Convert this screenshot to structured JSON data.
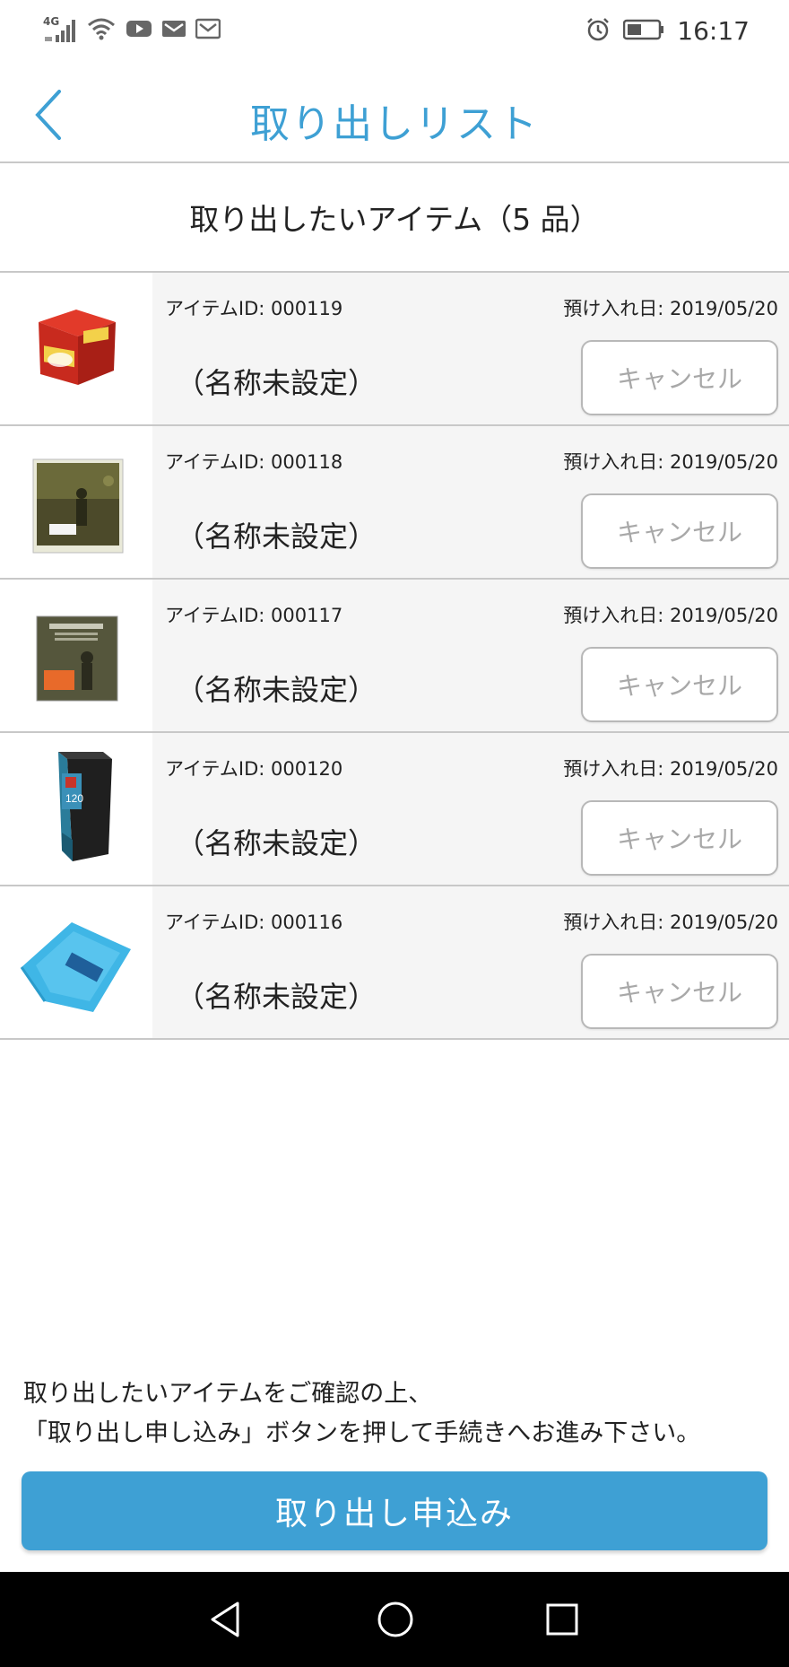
{
  "status_bar": {
    "network_label": "4G",
    "time": "16:17",
    "icons": [
      "signal-icon",
      "wifi-icon",
      "youtube-icon",
      "gmail-icon",
      "gmail-icon",
      "alarm-icon",
      "battery-icon"
    ]
  },
  "header": {
    "back_icon": "chevron-left-icon",
    "title": "取り出しリスト"
  },
  "section": {
    "heading": "取り出したいアイテム（5 品）"
  },
  "items": [
    {
      "id_label": "アイテムID: 000119",
      "date_label": "預け入れ日: 2019/05/20",
      "name": "（名称未設定）",
      "cancel_label": "キャンセル",
      "thumb": "red-tin-box-image"
    },
    {
      "id_label": "アイテムID: 000118",
      "date_label": "預け入れ日: 2019/05/20",
      "name": "（名称未設定）",
      "cancel_label": "キャンセル",
      "thumb": "vinyl-record-image"
    },
    {
      "id_label": "アイテムID: 000117",
      "date_label": "預け入れ日: 2019/05/20",
      "name": "（名称未設定）",
      "cancel_label": "キャンセル",
      "thumb": "vinyl-record-image"
    },
    {
      "id_label": "アイテムID: 000120",
      "date_label": "預け入れ日: 2019/05/20",
      "name": "（名称未設定）",
      "cancel_label": "キャンセル",
      "thumb": "storage-box-image"
    },
    {
      "id_label": "アイテムID: 000116",
      "date_label": "預け入れ日: 2019/05/20",
      "name": "（名称未設定）",
      "cancel_label": "キャンセル",
      "thumb": "blue-towel-image"
    }
  ],
  "instruction": {
    "line1": "取り出したいアイテムをご確認の上、",
    "line2": "「取り出し申し込み」ボタンを押して手続きへお進み下さい。"
  },
  "submit": {
    "label": "取り出し申込み"
  },
  "nav": {
    "icons": [
      "back-triangle-icon",
      "home-circle-icon",
      "recents-square-icon"
    ]
  },
  "colors": {
    "accent": "#3ea0d4",
    "row_bg": "#f5f5f5",
    "divider": "#c8c8c8",
    "cancel_text": "#a8a8a8"
  }
}
